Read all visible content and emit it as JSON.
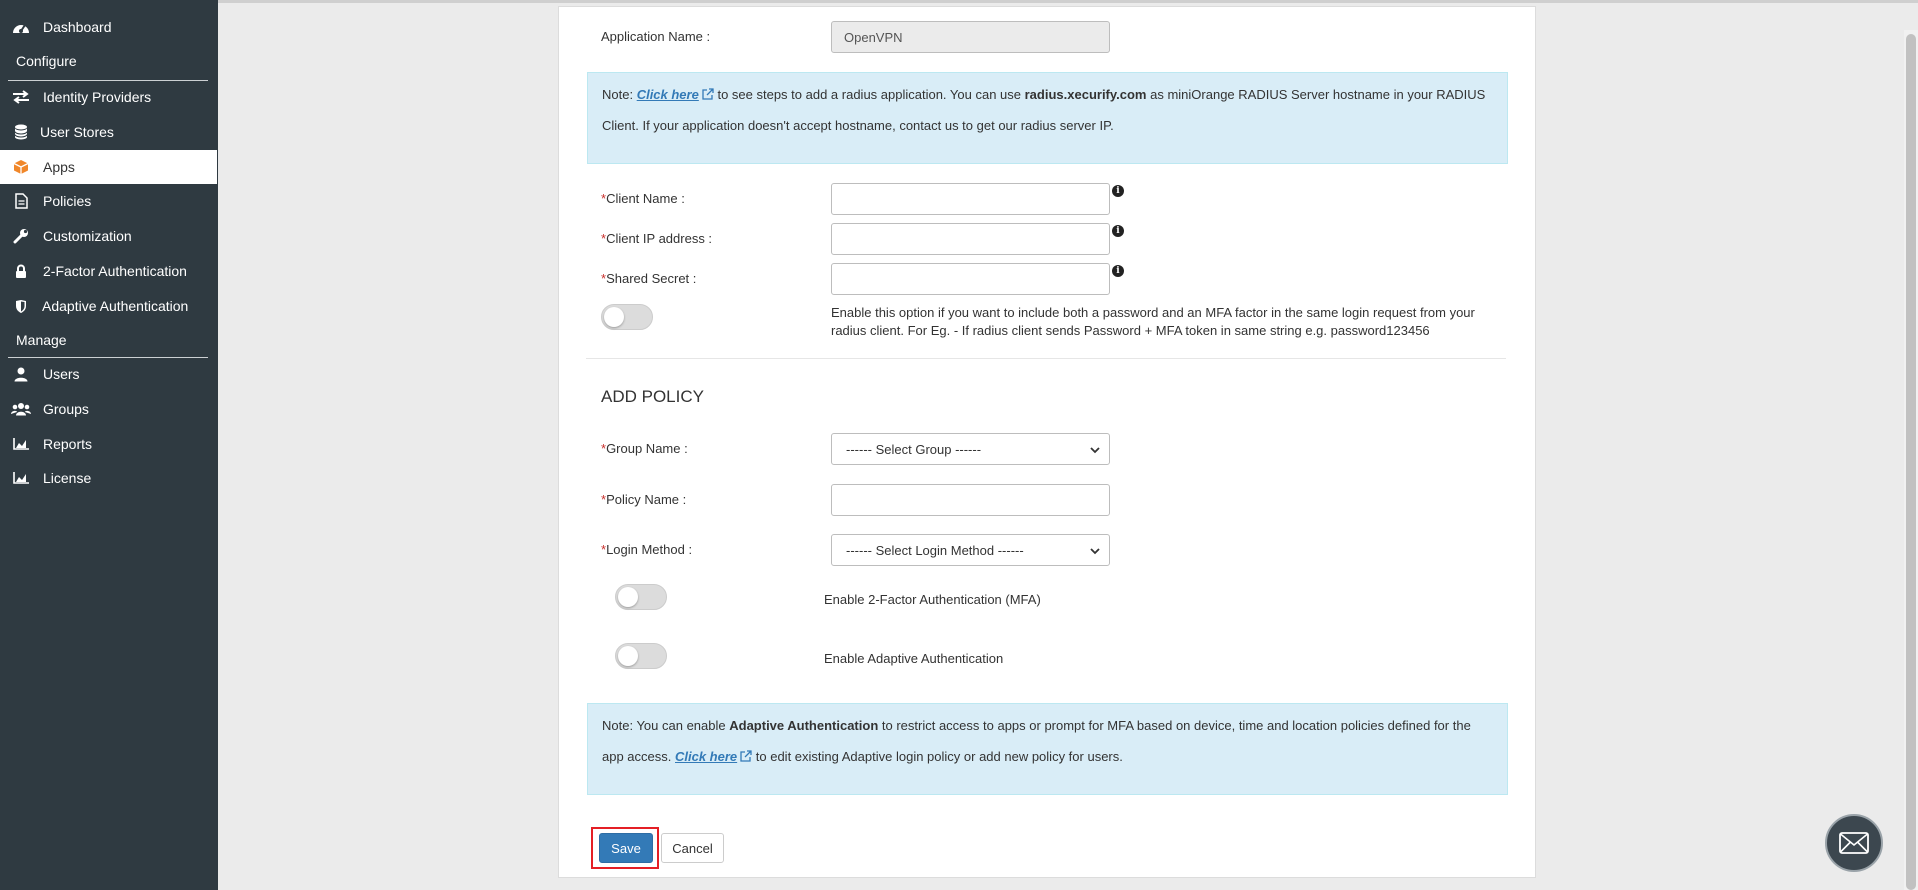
{
  "sidebar": {
    "items": [
      {
        "label": "Dashboard",
        "icon": "dashboard-icon"
      },
      {
        "label": "Identity Providers",
        "icon": "exchange-icon"
      },
      {
        "label": "User Stores",
        "icon": "database-icon"
      },
      {
        "label": "Apps",
        "icon": "cube-icon",
        "active": true
      },
      {
        "label": "Policies",
        "icon": "document-icon"
      },
      {
        "label": "Customization",
        "icon": "wrench-icon"
      },
      {
        "label": "2-Factor Authentication",
        "icon": "lock-icon"
      },
      {
        "label": "Adaptive Authentication",
        "icon": "shield-icon"
      },
      {
        "label": "Users",
        "icon": "user-icon"
      },
      {
        "label": "Groups",
        "icon": "users-icon"
      },
      {
        "label": "Reports",
        "icon": "chart-icon"
      },
      {
        "label": "License",
        "icon": "chart-icon"
      }
    ],
    "sections": {
      "configure": "Configure",
      "manage": "Manage"
    }
  },
  "form": {
    "app_name_label": "Application Name :",
    "app_name_value": "OpenVPN",
    "note1": {
      "prefix": "Note: ",
      "link": "Click here",
      "mid": " to see steps to add a radius application. You can use ",
      "bold": "radius.xecurify.com",
      "suffix": " as miniOrange RADIUS Server hostname in your RADIUS Client. If your application doesn't accept hostname, contact us to get our radius server IP."
    },
    "required_mark": "*",
    "client_name_label": "Client Name :",
    "client_ip_label": "Client IP address :",
    "shared_secret_label": "Shared Secret :",
    "info_glyph": "i",
    "combined_desc": "Enable this option if you want to include both a password and an MFA factor in the same login request from your radius client. For Eg. - If radius client sends Password + MFA token in same string e.g. password123456",
    "policy_heading": "ADD POLICY",
    "group_name_label": "Group Name :",
    "group_select": "------ Select Group ------",
    "policy_name_label": "Policy Name :",
    "login_method_label": "Login Method :",
    "login_method_select": "------ Select Login Method ------",
    "mfa_label": "Enable 2-Factor Authentication (MFA)",
    "adaptive_label": "Enable Adaptive Authentication",
    "note2": {
      "prefix": "Note: You can enable ",
      "bold": "Adaptive Authentication",
      "mid": " to restrict access to apps or prompt for MFA based on device, time and location policies defined for the app access. ",
      "link": "Click here",
      "suffix": " to edit existing Adaptive login policy or add new policy for users."
    },
    "save_label": "Save",
    "cancel_label": "Cancel"
  },
  "colors": {
    "sidebar_bg": "#2f3a41",
    "accent": "#337ab7",
    "note_bg": "#d9edf7",
    "required": "#c9302c",
    "highlight": "#e41f25"
  }
}
